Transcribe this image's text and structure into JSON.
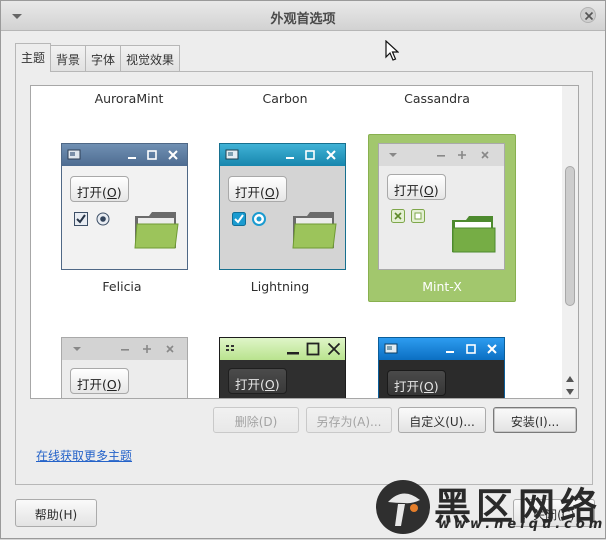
{
  "window": {
    "title": "外观首选项"
  },
  "tabs": [
    {
      "label": "主题",
      "active": true
    },
    {
      "label": "背景",
      "active": false
    },
    {
      "label": "字体",
      "active": false
    },
    {
      "label": "视觉效果",
      "active": false
    }
  ],
  "themes_top_labels": [
    "AuroraMint",
    "Carbon",
    "Cassandra"
  ],
  "themes": [
    {
      "name": "Felicia",
      "button_label": "打开(",
      "button_key": "O",
      "button_tail": ")",
      "selected": false
    },
    {
      "name": "Lightning",
      "button_label": "打开(",
      "button_key": "O",
      "button_tail": ")",
      "selected": false
    },
    {
      "name": "Mint-X",
      "button_label": "打开(",
      "button_key": "O",
      "button_tail": ")",
      "selected": true
    }
  ],
  "themes_partial": [
    {
      "button_label": "打开(",
      "button_key": "O",
      "button_tail": ")"
    },
    {
      "button_label": "打开(",
      "button_key": "O",
      "button_tail": ")"
    },
    {
      "button_label": "打开(",
      "button_key": "O",
      "button_tail": ")"
    }
  ],
  "actions": {
    "delete_label": "删除(D)",
    "save_as_label": "另存为(A)...",
    "customize_label": "自定义(U)...",
    "install_label": "安装(I)..."
  },
  "online_link": "在线获取更多主题",
  "help_label": "帮助(H)",
  "close_label": "关闭(C)",
  "watermark": {
    "text": "黑区网络",
    "url": "www.heiqu.com"
  },
  "colors": {
    "selection": "#a2c76d",
    "felicia_title": "#5a7596",
    "lightning_title": "#1f8db5",
    "mintx_title": "#d9d9d9",
    "link": "#2563c9"
  }
}
